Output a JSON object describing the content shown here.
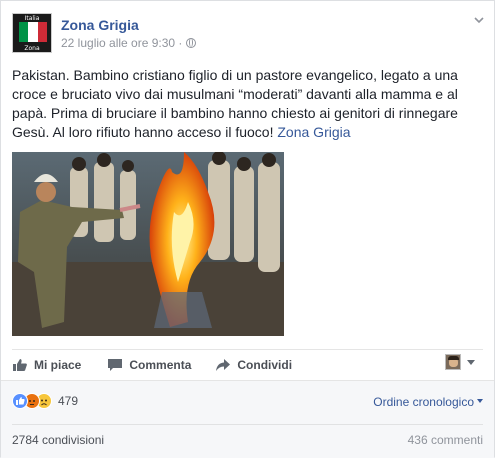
{
  "post": {
    "page_name": "Zona Grigia",
    "avatar_caption_top": "Italia",
    "avatar_caption_bottom": "Zona Grigia",
    "timestamp": "22 luglio alle ore 9:30 · ",
    "text": "Pakistan. Bambino cristiano figlio di un pastore evangelico, legato a una croce e bruciato vivo dai musulmani “moderati” davanti alla mamma e al papà. Prima di bruciare il bambino hanno chiesto ai genitori di rinnegare Gesù. Al loro rifiuto hanno acceso il fuoco! ",
    "text_link": "Zona Grigia"
  },
  "actions": {
    "like": "Mi piace",
    "comment": "Commenta",
    "share": "Condividi"
  },
  "stats": {
    "reaction_count": "479",
    "order_label": "Ordine cronologico",
    "shares": "2784 condivisioni",
    "comments": "436 commenti"
  },
  "icons": {
    "privacy": "globe-icon",
    "menu": "chevron-down-icon",
    "reactions": [
      "like-reaction-icon",
      "angry-reaction-icon",
      "sad-reaction-icon"
    ]
  },
  "colors": {
    "link": "#365899",
    "text": "#1d2129",
    "muted": "#90949c",
    "flag_green": "#009246",
    "flag_white": "#ffffff",
    "flag_red": "#ce2b37",
    "fire": "#ff8a00"
  }
}
